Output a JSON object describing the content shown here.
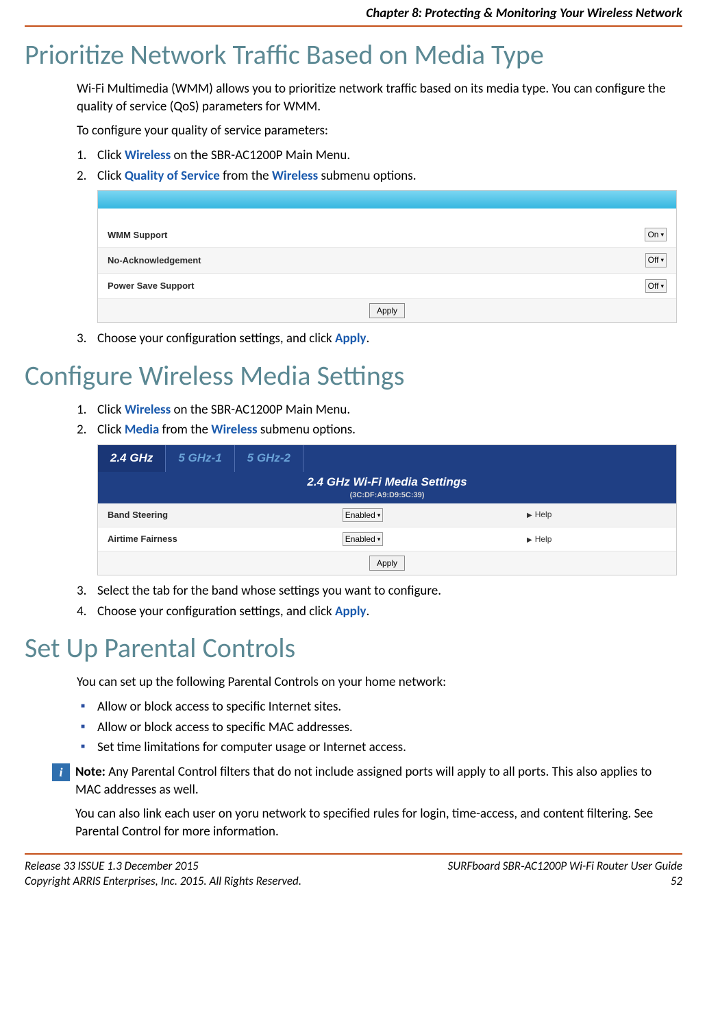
{
  "header": {
    "chapter": "Chapter 8: Protecting & Monitoring Your Wireless Network"
  },
  "section1": {
    "title": "Prioritize Network Traffic Based on Media Type",
    "intro1": "Wi-Fi Multimedia (WMM) allows you to prioritize network traffic based on its media type. You can configure the quality of service (QoS) parameters for WMM.",
    "intro2": "To configure your quality of service parameters:",
    "step1_a": "Click ",
    "step1_link": "Wireless",
    "step1_b": " on the SBR-AC1200P Main Menu.",
    "step2_a": "Click ",
    "step2_link1": "Quality of Service",
    "step2_b": " from the ",
    "step2_link2": "Wireless",
    "step2_c": " submenu options.",
    "ss": {
      "rows": [
        {
          "label": "WMM Support",
          "value": "On"
        },
        {
          "label": "No-Acknowledgement",
          "value": "Off"
        },
        {
          "label": "Power Save Support",
          "value": "Off"
        }
      ],
      "apply": "Apply"
    },
    "step3_a": "Choose your configuration settings, and click ",
    "step3_link": "Apply",
    "step3_b": "."
  },
  "section2": {
    "title": "Configure Wireless Media Settings",
    "step1_a": "Click ",
    "step1_link": "Wireless",
    "step1_b": " on the SBR-AC1200P Main Menu.",
    "step2_a": "Click ",
    "step2_link1": "Media",
    "step2_b": " from the ",
    "step2_link2": "Wireless",
    "step2_c": " submenu options.",
    "ss": {
      "tabs": [
        "2.4 GHz",
        "5 GHz-1",
        "5 GHz-2"
      ],
      "banner": "2.4 GHz Wi-Fi Media Settings",
      "mac": "(3C:DF:A9:D9:5C:39)",
      "rows": [
        {
          "label": "Band Steering",
          "value": "Enabled",
          "help": "Help"
        },
        {
          "label": "Airtime Fairness",
          "value": "Enabled",
          "help": "Help"
        }
      ],
      "apply": "Apply"
    },
    "step3": "Select the tab for the band whose settings you want to configure.",
    "step4_a": "Choose your configuration settings, and click ",
    "step4_link": "Apply",
    "step4_b": "."
  },
  "section3": {
    "title": "Set Up Parental Controls",
    "intro": "You can set up the following Parental Controls on your home network:",
    "bullets": [
      "Allow or block access to specific Internet sites.",
      "Allow or block access to specific MAC addresses.",
      "Set time limitations for computer usage or Internet access."
    ],
    "note_label": "Note:",
    "note_text": " Any Parental Control filters that do not include assigned ports will apply to all ports. This also applies to MAC addresses as well.",
    "closing": "You can also link each user on yoru network to specified rules for login, time-access, and content filtering. See Parental Control for more information."
  },
  "footer": {
    "left1": "Release 33 ISSUE 1.3    December 2015",
    "left2": "Copyright ARRIS Enterprises, Inc. 2015. All Rights Reserved.",
    "right1": "SURFboard SBR‑AC1200P Wi-Fi Router User Guide",
    "right2": "52"
  }
}
